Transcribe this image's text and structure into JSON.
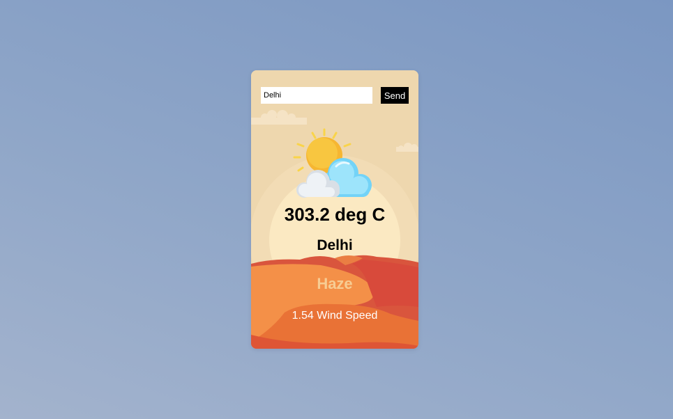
{
  "search": {
    "value": "Delhi",
    "button_label": "Send"
  },
  "weather": {
    "icon": "sun-behind-cloud-icon",
    "temperature": "303.2 deg C",
    "city": "Delhi",
    "condition": "Haze",
    "wind": "1.54 Wind Speed"
  },
  "colors": {
    "page_background": "#8fa6c8",
    "card_sky": "#eed7ae",
    "sun_glow": "#fbe9c2",
    "sand_light": "#f49048",
    "sand_dark": "#d6483a",
    "condition_text": "#f7cc93",
    "button": "#000000"
  }
}
